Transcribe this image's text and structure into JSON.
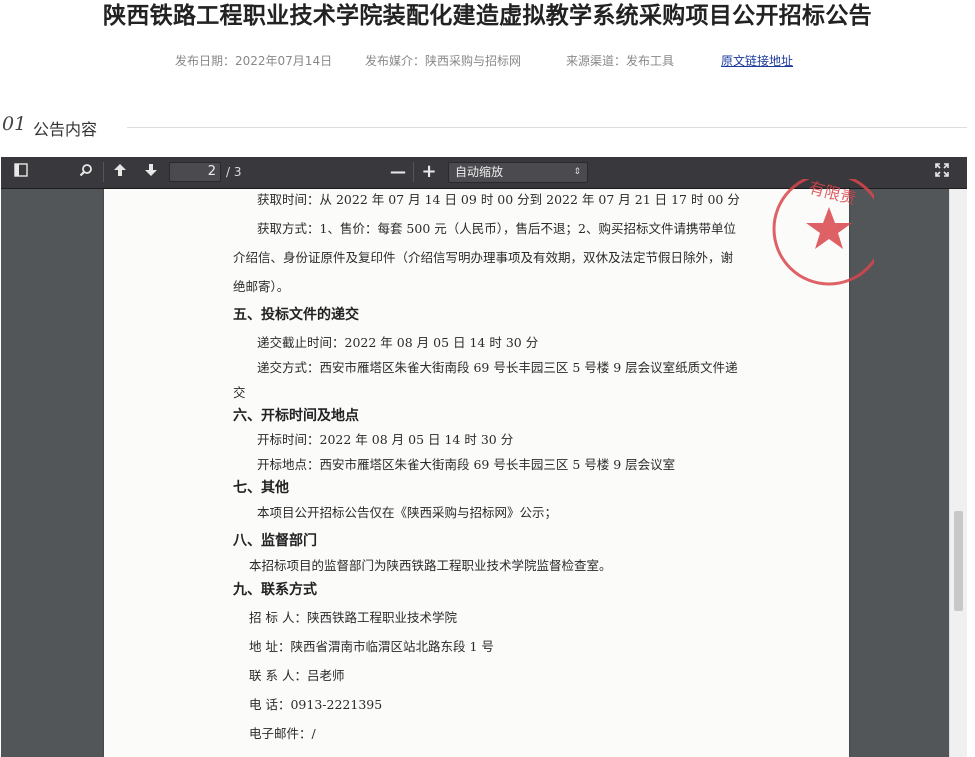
{
  "header": {
    "title": "陕西铁路工程职业技术学院装配化建造虚拟教学系统采购项目公开招标公告",
    "publish_date": "发布日期：2022年07月14日",
    "publish_media": "发布媒介：陕西采购与招标网",
    "source_channel": "来源渠道：发布工具",
    "source_link": "原文链接地址"
  },
  "section": {
    "number": "01",
    "label": "公告内容"
  },
  "viewer": {
    "current_page": "2",
    "page_total": "/ 3",
    "zoom_minus": "—",
    "zoom_plus": "+",
    "zoom_value": "自动缩放",
    "zoom_arrow": "⇕",
    "icons": [
      "sidebar-toggle-icon",
      "search-icon",
      "previous-page-icon",
      "next-page-icon",
      "zoom-out-icon",
      "zoom-in-icon",
      "fullscreen-icon"
    ]
  },
  "document": {
    "line1": "获取时间：从 2022 年 07 月 14 日  09 时 00 分到 2022 年 07 月 21 日  17 时 00 分",
    "line2": "获取方式：1、售价：每套 500 元（人民币），售后不退；2、购买招标文件请携带单位",
    "line3": "介绍信、身份证原件及复印件（介绍信写明办理事项及有效期，双休及法定节假日除外，谢",
    "line4": "绝邮寄）。",
    "h5": "五、投标文件的递交",
    "line5": "递交截止时间：2022 年 08 月 05 日  14 时 30 分",
    "line6": "递交方式：西安市雁塔区朱雀大街南段 69 号长丰园三区 5 号楼 9 层会议室纸质文件递",
    "line7": "交",
    "h6": "六、开标时间及地点",
    "line8": "开标时间：2022 年 08 月 05 日  14 时 30 分",
    "line9": "开标地点：西安市雁塔区朱雀大街南段 69 号长丰园三区 5 号楼 9 层会议室",
    "h7": "七、其他",
    "line10": "本项目公开招标公告仅在《陕西采购与招标网》公示；",
    "h8": "八、监督部门",
    "line11": "本招标项目的监督部门为陕西铁路工程职业技术学院监督检查室。",
    "h9": "九、联系方式",
    "line12": "招  标  人：陕西铁路工程职业技术学院",
    "line13": "地      址：陕西省渭南市临渭区站北路东段 1 号",
    "line14": "联  系  人：吕老师",
    "line15": "电      话：0913-2221395",
    "line16": "电子邮件：/",
    "stamp_text": "有限责"
  },
  "colors": {
    "stamp_red": "#d8454b",
    "toolbar": "#38383d",
    "link": "#1a3a9c"
  }
}
